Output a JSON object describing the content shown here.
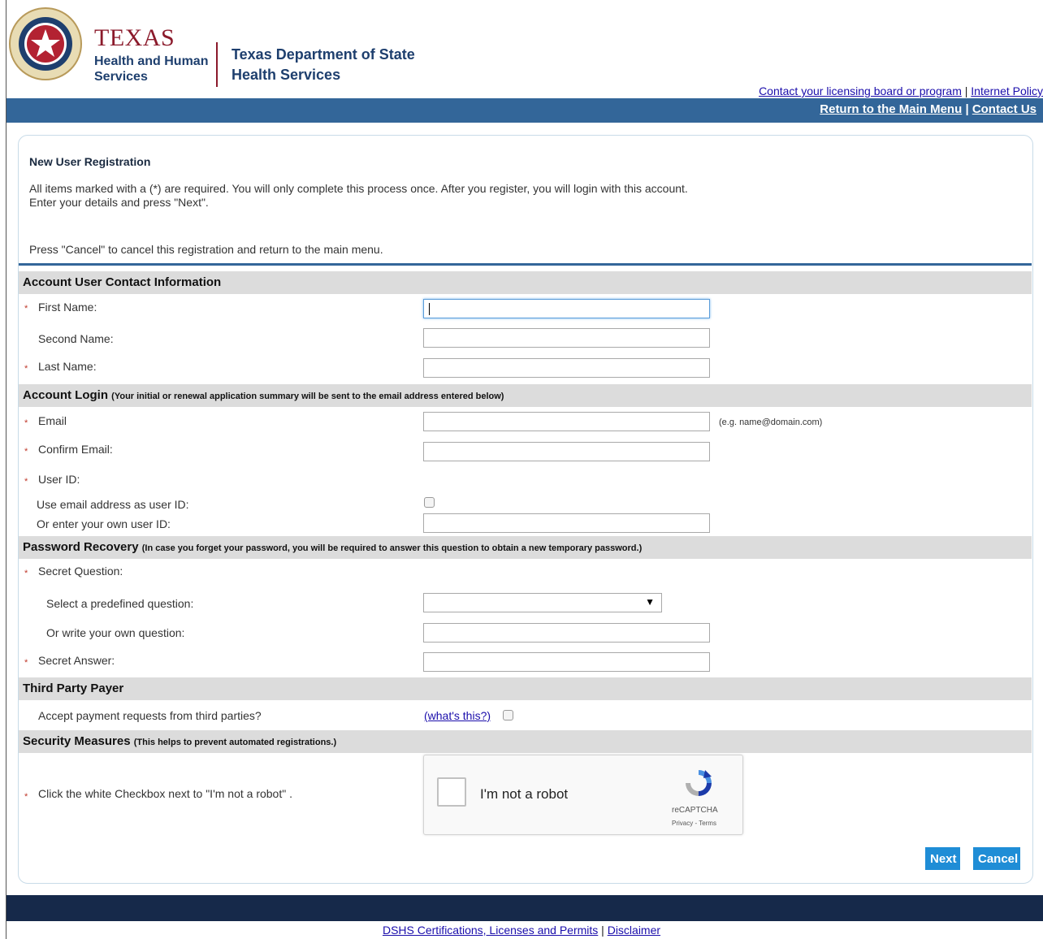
{
  "header": {
    "brand_title": "TEXAS",
    "brand_sub_1": "Health and Human",
    "brand_sub_2": "Services",
    "dept_1": "Texas Department of State",
    "dept_2": "Health Services",
    "top_link_1": "Contact your licensing board or program",
    "top_link_2": "Internet Policy",
    "sep": "|"
  },
  "nav": {
    "main_menu": "Return to the Main Menu",
    "contact": "Contact Us",
    "sep": "|"
  },
  "intro": {
    "title": "New User Registration",
    "text": "All items marked with a (*) are required. You will only complete this process once. After you register, you will login with this account.\nEnter your details and press \"Next\".",
    "cancel_text": "Press \"Cancel\" to cancel this registration and return to the main menu."
  },
  "sections": {
    "contact": "Account User Contact Information",
    "login": "Account Login",
    "login_note": "(Your initial or renewal application summary will be sent to the email address entered below)",
    "recovery": "Password Recovery",
    "recovery_note": "(In case you forget your password, you will be required to answer this question to obtain a new temporary password.)",
    "payer": "Third Party Payer",
    "security": "Security Measures",
    "security_note": "(This helps to prevent automated registrations.)"
  },
  "required_mark": "*",
  "fields": {
    "first_name": "First Name:",
    "second_name": "Second Name:",
    "last_name": "Last Name:",
    "email": "Email",
    "email_hint": "(e.g. name@domain.com)",
    "confirm_email": "Confirm Email:",
    "user_id": "User ID:",
    "use_email": "Use email address as user ID:",
    "own_user_id": "Or enter your own user ID:",
    "secret_question": "Secret Question:",
    "predefined_q": "Select a predefined question:",
    "own_q": "Or write your own question:",
    "secret_answer": "Secret Answer:",
    "third_party": "Accept payment requests from third parties?",
    "whats_this": "(what's this?)",
    "robot_instruction": "Click the white Checkbox next to \"I'm not a robot\" ."
  },
  "captcha": {
    "label": "I'm not a robot",
    "brand": "reCAPTCHA",
    "terms": "Privacy - Terms"
  },
  "buttons": {
    "next": "Next",
    "cancel": "Cancel"
  },
  "footer": {
    "certs": "DSHS Certifications, Licenses and Permits",
    "disclaimer": "Disclaimer",
    "sep": "|"
  },
  "colors": {
    "nav_blue": "#336699",
    "footer_navy": "#16294a",
    "button_blue": "#1f8dd6",
    "texas_red": "#8b1a2b"
  }
}
